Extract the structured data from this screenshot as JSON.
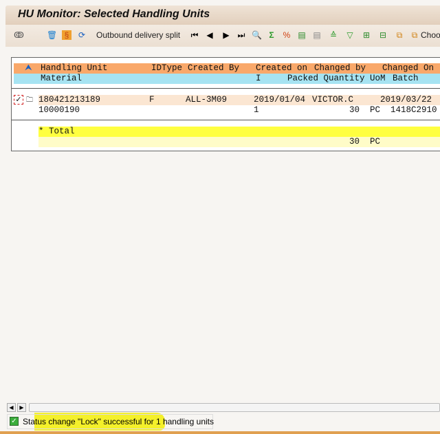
{
  "window": {
    "title": "HU Monitor: Selected Handling Units"
  },
  "toolbar": {
    "outbound_split_label": "Outbound delivery split",
    "choose_label": "Choo"
  },
  "list": {
    "header1": {
      "handling_unit": "Handling Unit",
      "idtype": "IDType",
      "created_by": "Created By",
      "created_on": "Created on",
      "changed_by": "Changed by",
      "changed_on": "Changed On"
    },
    "header2": {
      "material": "Material",
      "i": "I",
      "packed_quantity": "Packed Quantity",
      "uom": "UoM",
      "batch": "Batch"
    },
    "rows": [
      {
        "handling_unit": "180421213189",
        "idtype": "F",
        "created_by": "ALL-3M09",
        "created_on": "2019/01/04",
        "changed_by": "VICTOR.C",
        "changed_on": "2019/03/22",
        "material": "10000190",
        "i": "1",
        "packed_quantity": "30",
        "uom": "PC",
        "batch": "1418C2910",
        "selected": true
      }
    ],
    "total": {
      "label": "* Total",
      "quantity": "30",
      "uom": "PC"
    }
  },
  "status": {
    "message": "Status change \"Lock\" successful for 1 handling units",
    "type": "success"
  },
  "colors": {
    "header1": "#f9a86a",
    "header2": "#a6e3f2",
    "row": "#fbe6d2",
    "total": "#ffff40",
    "total_sub": "#fffcc8"
  }
}
